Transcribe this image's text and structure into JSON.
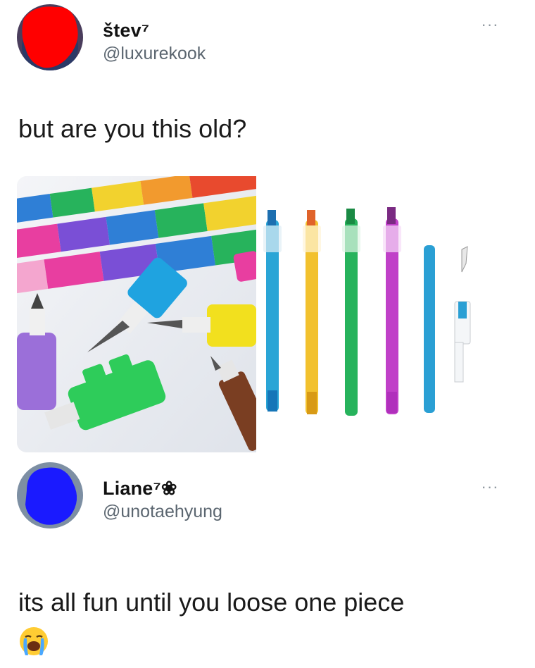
{
  "tweet": {
    "name": "štev⁷",
    "handle": "@luxurekook",
    "more_label": "···",
    "text": "but are you this old?",
    "avatar_color": "#ff0000"
  },
  "reply": {
    "name": "Liane⁷❀",
    "handle": "@unotaehyung",
    "more_label": "···",
    "text": "its all fun until you loose one piece",
    "emoji": "loudly-crying-face",
    "avatar_color": "#1a1aff"
  },
  "media": {
    "pencil_colors": [
      "#2aa5d6",
      "#f2c12e",
      "#27b35c",
      "#c040c8"
    ],
    "loose_pencil_color": "#2a9fd4"
  }
}
